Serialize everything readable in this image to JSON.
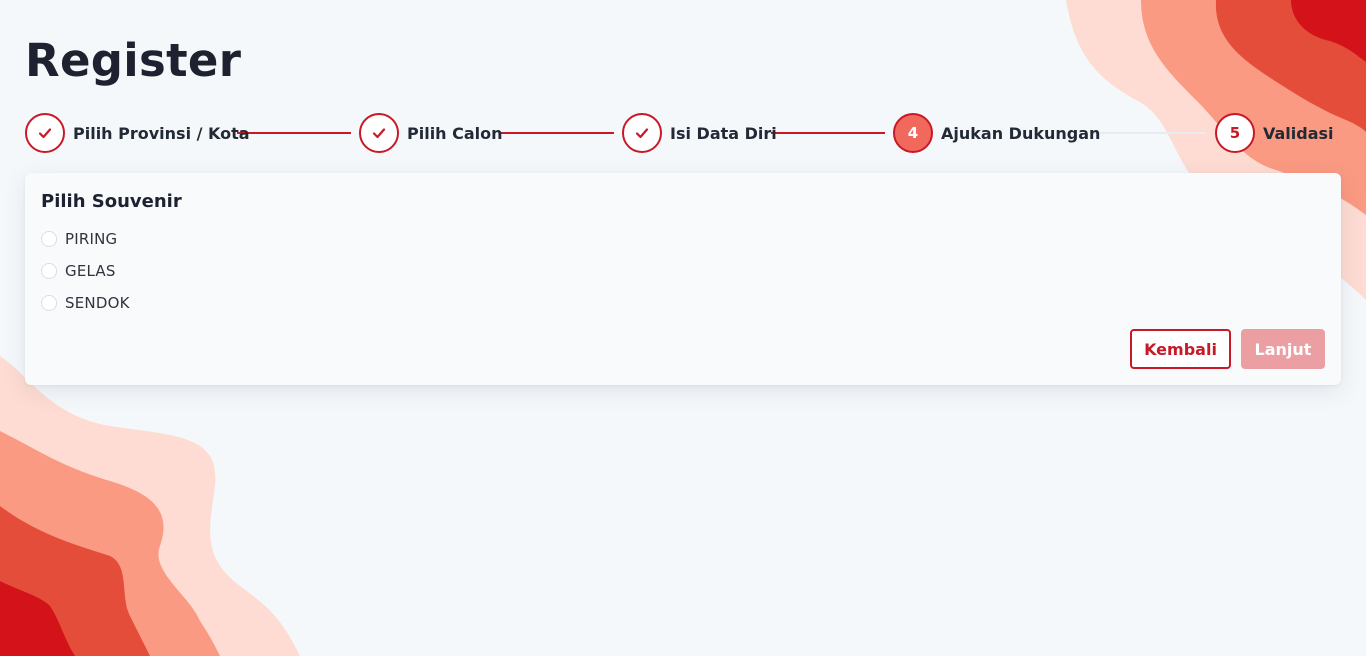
{
  "page": {
    "title": "Register"
  },
  "colors": {
    "accent": "#c81927",
    "active_step": "#f1685d",
    "disabled_button": "#eb9fa3"
  },
  "stepper": {
    "steps": [
      {
        "label": "Pilih Provinsi / Kota",
        "state": "done",
        "icon": "check-icon"
      },
      {
        "label": "Pilih Calon",
        "state": "done",
        "icon": "check-icon"
      },
      {
        "label": "Isi Data Diri",
        "state": "done",
        "icon": "check-icon"
      },
      {
        "label": "Ajukan Dukungan",
        "state": "active",
        "number": "4"
      },
      {
        "label": "Validasi",
        "state": "pending",
        "number": "5"
      }
    ]
  },
  "form": {
    "title": "Pilih Souvenir",
    "options": [
      {
        "label": "PIRING",
        "selected": false
      },
      {
        "label": "GELAS",
        "selected": false
      },
      {
        "label": "SENDOK",
        "selected": false
      }
    ],
    "back_label": "Kembali",
    "next_label": "Lanjut",
    "next_disabled": true
  }
}
